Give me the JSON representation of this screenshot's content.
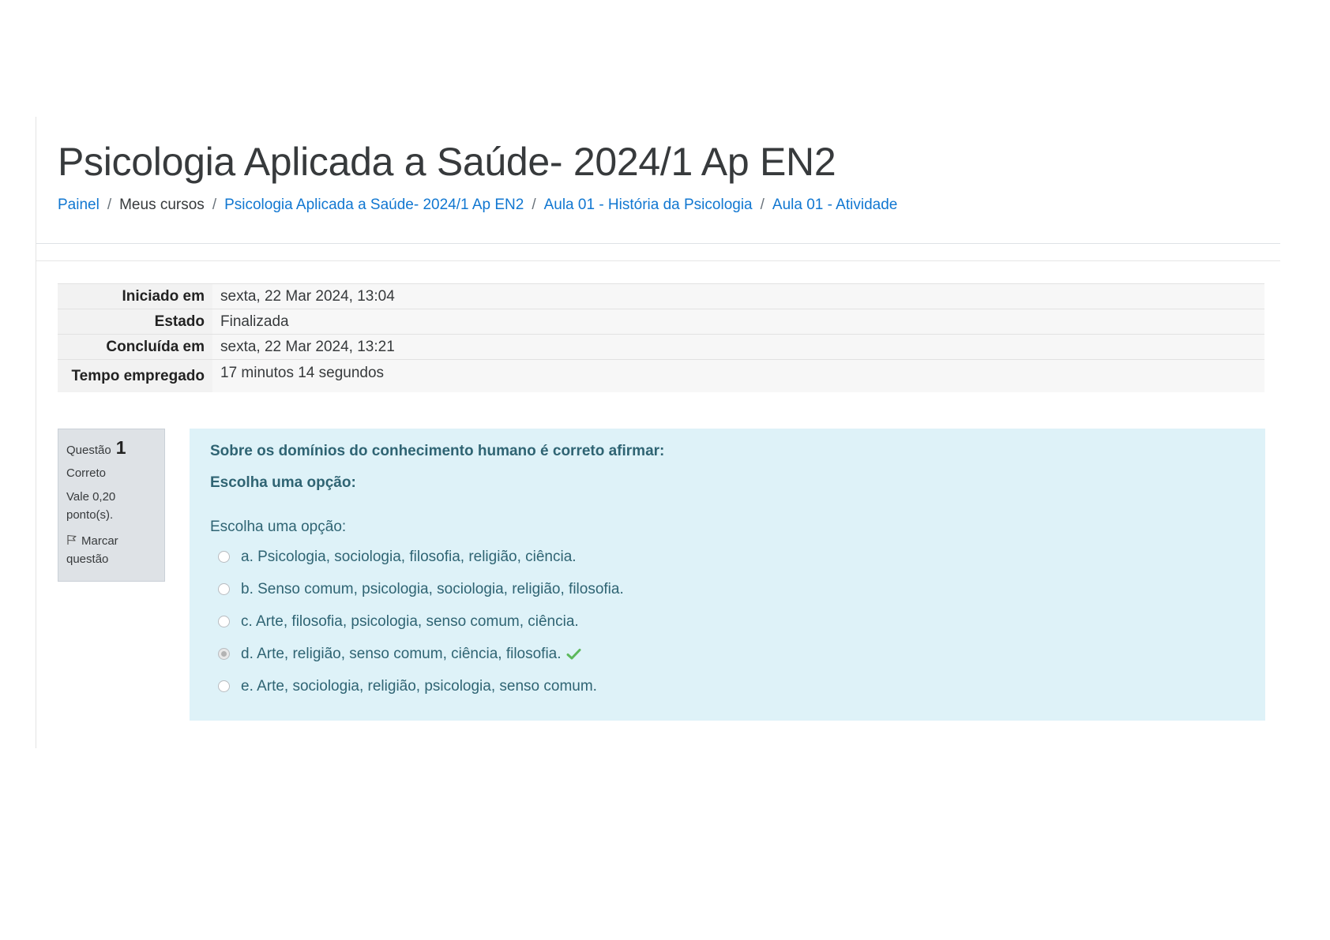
{
  "header": {
    "title": "Psicologia Aplicada a Saúde- 2024/1 Ap EN2",
    "breadcrumb": [
      {
        "label": "Painel",
        "link": true
      },
      {
        "label": "Meus cursos",
        "link": false
      },
      {
        "label": "Psicologia Aplicada a Saúde- 2024/1 Ap EN2",
        "link": true
      },
      {
        "label": "Aula 01 - História da Psicologia",
        "link": true
      },
      {
        "label": "Aula 01 - Atividade",
        "link": true
      }
    ],
    "separator": "/"
  },
  "summary": {
    "rows": [
      {
        "label": "Iniciado em",
        "value": "sexta, 22 Mar 2024, 13:04"
      },
      {
        "label": "Estado",
        "value": "Finalizada"
      },
      {
        "label": "Concluída em",
        "value": "sexta, 22 Mar 2024, 13:21"
      },
      {
        "label": "Tempo empregado",
        "value": "17 minutos 14 segundos"
      }
    ]
  },
  "question": {
    "number_label": "Questão",
    "number": "1",
    "state": "Correto",
    "grade": "Vale 0,20 ponto(s).",
    "flag_label": "Marcar questão",
    "text": "Sobre os domínios do conhecimento humano é correto afirmar:",
    "prompt": "Escolha uma opção:",
    "answer_prompt": "Escolha uma opção:",
    "options": [
      {
        "label": "a. Psicologia, sociologia, filosofia, religião, ciência.",
        "checked": false,
        "correct": false
      },
      {
        "label": "b. Senso comum, psicologia, sociologia, religião, filosofia.",
        "checked": false,
        "correct": false
      },
      {
        "label": "c. Arte, filosofia, psicologia, senso comum, ciência.",
        "checked": false,
        "correct": false
      },
      {
        "label": "d. Arte, religião, senso comum, ciência, filosofia.",
        "checked": true,
        "correct": true
      },
      {
        "label": "e. Arte, sociologia, religião, psicologia, senso comum.",
        "checked": false,
        "correct": false
      }
    ]
  },
  "colors": {
    "link": "#1177d1",
    "formulation_bg": "#def2f8",
    "formulation_text": "#2f6473",
    "info_bg": "#dee2e6",
    "correct_check": "#5cb85c"
  },
  "icons": {
    "flag": "flag-outline-icon",
    "correct": "check-icon",
    "radio": "radio-button-icon"
  }
}
